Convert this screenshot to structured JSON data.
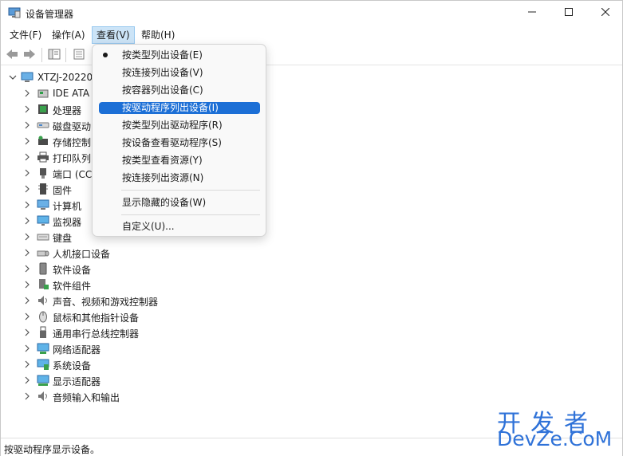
{
  "window": {
    "title": "设备管理器",
    "minimize_icon": "minimize-icon",
    "maximize_icon": "maximize-icon",
    "close_icon": "close-icon"
  },
  "menubar": {
    "items": [
      "文件(F)",
      "操作(A)",
      "查看(V)",
      "帮助(H)"
    ],
    "active": "查看(V)"
  },
  "toolbar": {
    "buttons": [
      "back-arrow-icon",
      "forward-arrow-icon",
      "console-tree-icon",
      "properties-icon"
    ]
  },
  "tree": {
    "root": "XTZJ-20220",
    "items": [
      {
        "label": "IDE ATA",
        "icon": "ide-controller-icon"
      },
      {
        "label": "处理器",
        "icon": "processor-icon"
      },
      {
        "label": "磁盘驱动",
        "icon": "disk-drive-icon"
      },
      {
        "label": "存储控制",
        "icon": "storage-controller-icon"
      },
      {
        "label": "打印队列",
        "icon": "printer-icon"
      },
      {
        "label": "端口 (CC",
        "icon": "port-icon"
      },
      {
        "label": "固件",
        "icon": "firmware-icon"
      },
      {
        "label": "计算机",
        "icon": "computer-icon"
      },
      {
        "label": "监视器",
        "icon": "monitor-icon"
      },
      {
        "label": "键盘",
        "icon": "keyboard-icon"
      },
      {
        "label": "人机接口设备",
        "icon": "hid-icon"
      },
      {
        "label": "软件设备",
        "icon": "software-device-icon"
      },
      {
        "label": "软件组件",
        "icon": "software-component-icon"
      },
      {
        "label": "声音、视频和游戏控制器",
        "icon": "sound-icon"
      },
      {
        "label": "鼠标和其他指针设备",
        "icon": "mouse-icon"
      },
      {
        "label": "通用串行总线控制器",
        "icon": "usb-icon"
      },
      {
        "label": "网络适配器",
        "icon": "network-adapter-icon"
      },
      {
        "label": "系统设备",
        "icon": "system-device-icon"
      },
      {
        "label": "显示适配器",
        "icon": "display-adapter-icon"
      },
      {
        "label": "音频输入和输出",
        "icon": "audio-io-icon"
      }
    ]
  },
  "view_menu": {
    "items": [
      {
        "label": "按类型列出设备(E)",
        "checked": true,
        "highlighted": false
      },
      {
        "label": "按连接列出设备(V)",
        "checked": false,
        "highlighted": false
      },
      {
        "label": "按容器列出设备(C)",
        "checked": false,
        "highlighted": false
      },
      {
        "label": "按驱动程序列出设备(I)",
        "checked": false,
        "highlighted": true
      },
      {
        "label": "按类型列出驱动程序(R)",
        "checked": false,
        "highlighted": false
      },
      {
        "label": "按设备查看驱动程序(S)",
        "checked": false,
        "highlighted": false
      },
      {
        "label": "按类型查看资源(Y)",
        "checked": false,
        "highlighted": false
      },
      {
        "label": "按连接列出资源(N)",
        "checked": false,
        "highlighted": false
      },
      {
        "label": "显示隐藏的设备(W)",
        "checked": false,
        "highlighted": false
      },
      {
        "label": "自定义(U)...",
        "checked": false,
        "highlighted": false
      }
    ],
    "highlight_color": "#1c6fd6"
  },
  "status": {
    "text": "按驱动程序显示设备。"
  },
  "watermark": {
    "line1": "开发者",
    "line2": "DevZe.CoM",
    "color": "#2f72d8"
  }
}
